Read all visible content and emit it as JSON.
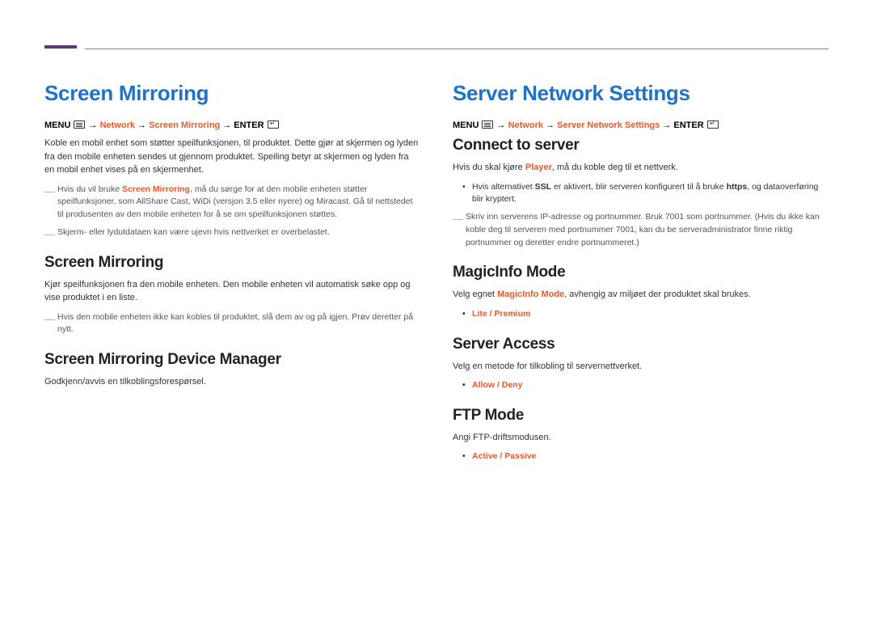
{
  "left": {
    "title": "Screen Mirroring",
    "breadcrumb": {
      "menu": "MENU",
      "sep1": "→",
      "path1": "Network",
      "sep2": "→",
      "path2": "Screen Mirroring",
      "sep3": "→",
      "enter": "ENTER"
    },
    "intro": "Koble en mobil enhet som støtter speilfunksjonen, til produktet. Dette gjør at skjermen og lyden fra den mobile enheten sendes ut gjennom produktet. Speiling betyr at skjermen og lyden fra en mobil enhet vises på en skjermenhet.",
    "note1_pre": "Hvis du vil bruke ",
    "note1_em": "Screen Mirroring",
    "note1_post": ", må du sørge for at den mobile enheten støtter speilfunksjoner, som AllShare Cast, WiDi (versjon 3.5 eller nyere) og Miracast. Gå til nettstedet til produsenten av den mobile enheten for å se om speilfunksjonen støttes.",
    "note2": "Skjerm- eller lydutdataen kan være ujevn hvis nettverket er overbelastet.",
    "sub1_title": "Screen Mirroring",
    "sub1_body": "Kjør speilfunksjonen fra den mobile enheten. Den mobile enheten vil automatisk søke opp og vise produktet i en liste.",
    "sub1_note": "Hvis den mobile enheten ikke kan kobles til produktet, slå dem av og på igjen. Prøv deretter på nytt.",
    "sub2_title": "Screen Mirroring Device Manager",
    "sub2_body": "Godkjenn/avvis en tilkoblingsforespørsel."
  },
  "right": {
    "title": "Server Network Settings",
    "breadcrumb": {
      "menu": "MENU",
      "sep1": "→",
      "path1": "Network",
      "sep2": "→",
      "path2": "Server Network Settings",
      "sep3": "→",
      "enter": "ENTER"
    },
    "connect_title": "Connect to server",
    "connect_body_pre": "Hvis du skal kjøre ",
    "connect_body_em": "Player",
    "connect_body_post": ", må du koble deg til et nettverk.",
    "connect_bullet_pre": "Hvis alternativet ",
    "connect_bullet_em": "SSL",
    "connect_bullet_mid": " er aktivert, blir serveren konfigurert til å bruke ",
    "connect_bullet_em2": "https",
    "connect_bullet_post": ", og dataoverføring blir kryptert.",
    "connect_note": "Skriv inn serverens IP-adresse og portnummer. Bruk 7001 som portnummer. (Hvis du ikke kan koble deg til serveren med portnummer 7001, kan du be serveradministrator finne riktig portnummer og deretter endre portnummeret.)",
    "magic_title": "MagicInfo Mode",
    "magic_body_pre": "Velg egnet ",
    "magic_body_em": "MagicInfo Mode",
    "magic_body_post": ", avhengig av miljøet der produktet skal brukes.",
    "magic_option": "Lite / Premium",
    "access_title": "Server Access",
    "access_body": "Velg en metode for tilkobling til servernettverket.",
    "access_option": "Allow / Deny",
    "ftp_title": "FTP Mode",
    "ftp_body": "Angi FTP-driftsmodusen.",
    "ftp_option": "Active / Passive"
  }
}
